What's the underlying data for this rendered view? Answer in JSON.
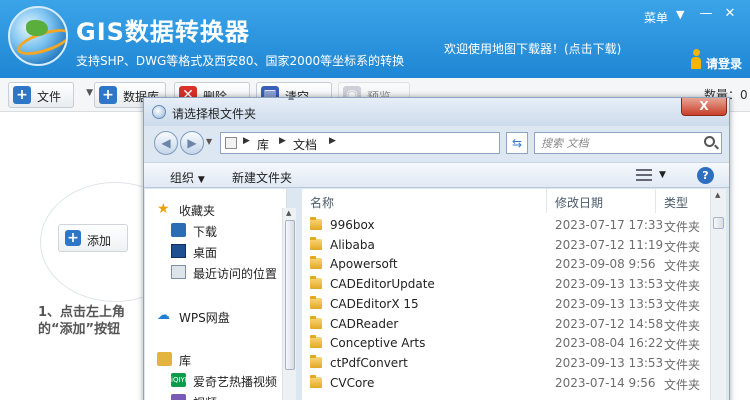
{
  "app": {
    "title": "GIS数据转换器",
    "subtitle": "支持SHP、DWG等格式及西安80、国家2000等坐标系的转换",
    "menu_label": "菜单",
    "welcome": "欢迎使用地图下载器！(点击下载)",
    "login_label": "请登录"
  },
  "toolbar": {
    "file_label": "文件",
    "database_label": "数据库",
    "delete_label": "删除",
    "clear_label": "清空",
    "preview_label": "预览",
    "count_text": "数量：0"
  },
  "main": {
    "add_label": "添加",
    "hint_line1": "1、点击左上角",
    "hint_line2": "的“添加”按钮"
  },
  "dialog": {
    "title": "请选择根文件夹",
    "close_glyph": "X",
    "breadcrumb": [
      "库",
      "文档"
    ],
    "search_placeholder": "搜索 文档",
    "organize_label": "组织",
    "new_folder_label": "新建文件夹",
    "nav_items": [
      {
        "label": "收藏夹",
        "icon": "star-icon"
      },
      {
        "label": "下载",
        "icon": "download-folder-icon"
      },
      {
        "label": "桌面",
        "icon": "desktop-icon"
      },
      {
        "label": "最近访问的位置",
        "icon": "recent-places-icon"
      },
      {
        "label": "WPS网盘",
        "icon": "cloud-icon"
      },
      {
        "label": "库",
        "icon": "library-icon"
      },
      {
        "label": "爱奇艺热播视频",
        "icon": "iqiyi-icon"
      },
      {
        "label": "视频",
        "icon": "video-library-icon"
      }
    ],
    "iqiyi_badge": "iQIYI",
    "columns": {
      "name": "名称",
      "date": "修改日期",
      "type": "类型"
    },
    "files": [
      {
        "name": "996box",
        "date": "2023-07-17 17:33",
        "type": "文件夹"
      },
      {
        "name": "Alibaba",
        "date": "2023-07-12 11:19",
        "type": "文件夹"
      },
      {
        "name": "Apowersoft",
        "date": "2023-09-08 9:56",
        "type": "文件夹"
      },
      {
        "name": "CADEditorUpdate",
        "date": "2023-09-13 13:53",
        "type": "文件夹"
      },
      {
        "name": "CADEditorX 15",
        "date": "2023-09-13 13:53",
        "type": "文件夹"
      },
      {
        "name": "CADReader",
        "date": "2023-07-12 14:58",
        "type": "文件夹"
      },
      {
        "name": "Conceptive Arts",
        "date": "2023-08-04 16:22",
        "type": "文件夹"
      },
      {
        "name": "ctPdfConvert",
        "date": "2023-09-13 13:53",
        "type": "文件夹"
      },
      {
        "name": "CVCore",
        "date": "2023-07-14 9:56",
        "type": "文件夹"
      }
    ]
  },
  "colors": {
    "header_blue": "#2590dc",
    "delete_red": "#d8322a",
    "clear_blue": "#3a5fb8",
    "add_blue": "#2e77c8",
    "folder_yellow": "#e9b53a"
  }
}
